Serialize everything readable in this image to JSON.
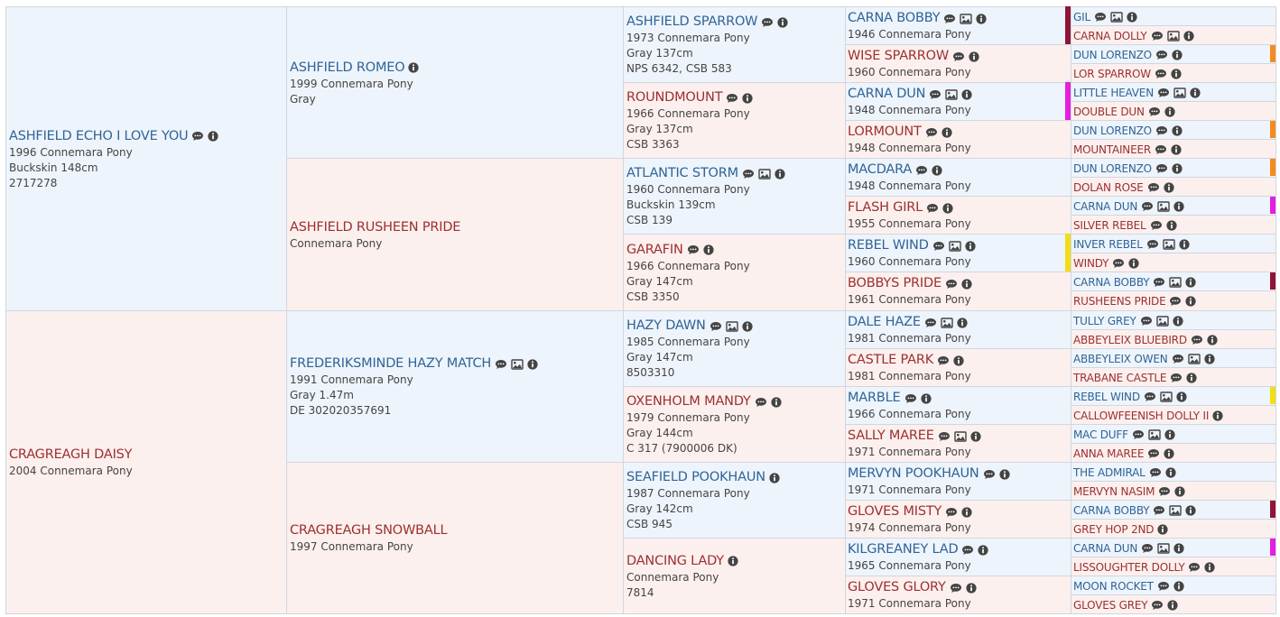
{
  "gen0": [
    {
      "name": "ASHFIELD ECHO I LOVE YOU",
      "sex": "m",
      "icons": [
        "comment-icon",
        "info-icon"
      ],
      "lines": [
        "1996 Connemara Pony",
        "Buckskin 148cm",
        "2717278"
      ]
    },
    {
      "name": "CRAGREAGH DAISY",
      "sex": "f",
      "icons": [],
      "lines": [
        "2004 Connemara Pony"
      ]
    }
  ],
  "gen1": [
    {
      "name": "ASHFIELD ROMEO",
      "sex": "m",
      "icons": [
        "info-icon"
      ],
      "lines": [
        "1999 Connemara Pony",
        "Gray"
      ]
    },
    {
      "name": "ASHFIELD RUSHEEN PRIDE",
      "sex": "f",
      "icons": [],
      "lines": [
        "Connemara Pony"
      ]
    },
    {
      "name": "FREDERIKSMINDE HAZY MATCH",
      "sex": "m",
      "icons": [
        "comment-icon",
        "photo-icon",
        "info-icon"
      ],
      "lines": [
        "1991 Connemara Pony",
        "Gray 1.47m",
        "DE 302020357691"
      ]
    },
    {
      "name": "CRAGREAGH SNOWBALL",
      "sex": "f",
      "icons": [],
      "lines": [
        "1997 Connemara Pony"
      ]
    }
  ],
  "gen2": [
    {
      "name": "ASHFIELD SPARROW",
      "sex": "m",
      "icons": [
        "comment-icon",
        "info-icon"
      ],
      "lines": [
        "1973 Connemara Pony",
        "Gray 137cm",
        "NPS 6342, CSB 583"
      ]
    },
    {
      "name": "ROUNDMOUNT",
      "sex": "f",
      "icons": [
        "comment-icon",
        "info-icon"
      ],
      "lines": [
        "1966 Connemara Pony",
        "Gray 137cm",
        "CSB 3363"
      ]
    },
    {
      "name": "ATLANTIC STORM",
      "sex": "m",
      "icons": [
        "comment-icon",
        "photo-icon",
        "info-icon"
      ],
      "lines": [
        "1960 Connemara Pony",
        "Buckskin 139cm",
        "CSB 139"
      ]
    },
    {
      "name": "GARAFIN",
      "sex": "f",
      "icons": [
        "comment-icon",
        "info-icon"
      ],
      "lines": [
        "1966 Connemara Pony",
        "Gray 147cm",
        "CSB 3350"
      ]
    },
    {
      "name": "HAZY DAWN",
      "sex": "m",
      "icons": [
        "comment-icon",
        "photo-icon",
        "info-icon"
      ],
      "lines": [
        "1985 Connemara Pony",
        "Gray 147cm",
        "8503310"
      ]
    },
    {
      "name": "OXENHOLM MANDY",
      "sex": "f",
      "icons": [
        "comment-icon",
        "info-icon"
      ],
      "lines": [
        "1979 Connemara Pony",
        "Gray 144cm",
        "C 317 (7900006 DK)"
      ]
    },
    {
      "name": "SEAFIELD POOKHAUN",
      "sex": "m",
      "icons": [
        "info-icon"
      ],
      "lines": [
        "1987 Connemara Pony",
        "Gray 142cm",
        "CSB 945"
      ]
    },
    {
      "name": "DANCING LADY",
      "sex": "f",
      "icons": [
        "info-icon"
      ],
      "lines": [
        "Connemara Pony",
        "7814"
      ]
    }
  ],
  "gen3": [
    {
      "name": "CARNA BOBBY",
      "sex": "m",
      "icons": [
        "comment-icon",
        "photo-icon",
        "info-icon"
      ],
      "lines": [
        "1946 Connemara Pony"
      ]
    },
    {
      "name": "WISE SPARROW",
      "sex": "f",
      "icons": [
        "comment-icon",
        "info-icon"
      ],
      "lines": [
        "1960 Connemara Pony"
      ]
    },
    {
      "name": "CARNA DUN",
      "sex": "m",
      "icons": [
        "comment-icon",
        "photo-icon",
        "info-icon"
      ],
      "lines": [
        "1948 Connemara Pony"
      ]
    },
    {
      "name": "LORMOUNT",
      "sex": "f",
      "icons": [
        "comment-icon",
        "info-icon"
      ],
      "lines": [
        "1948 Connemara Pony"
      ]
    },
    {
      "name": "MACDARA",
      "sex": "m",
      "icons": [
        "comment-icon",
        "info-icon"
      ],
      "lines": [
        "1948 Connemara Pony"
      ]
    },
    {
      "name": "FLASH GIRL",
      "sex": "f",
      "icons": [
        "comment-icon",
        "info-icon"
      ],
      "lines": [
        "1955 Connemara Pony"
      ]
    },
    {
      "name": "REBEL WIND",
      "sex": "m",
      "icons": [
        "comment-icon",
        "photo-icon",
        "info-icon"
      ],
      "lines": [
        "1960 Connemara Pony"
      ]
    },
    {
      "name": "BOBBYS PRIDE",
      "sex": "f",
      "icons": [
        "comment-icon",
        "info-icon"
      ],
      "lines": [
        "1961 Connemara Pony"
      ]
    },
    {
      "name": "DALE HAZE",
      "sex": "m",
      "icons": [
        "comment-icon",
        "photo-icon",
        "info-icon"
      ],
      "lines": [
        "1981 Connemara Pony"
      ]
    },
    {
      "name": "CASTLE PARK",
      "sex": "f",
      "icons": [
        "comment-icon",
        "info-icon"
      ],
      "lines": [
        "1981 Connemara Pony"
      ]
    },
    {
      "name": "MARBLE",
      "sex": "m",
      "icons": [
        "comment-icon",
        "info-icon"
      ],
      "lines": [
        "1966 Connemara Pony"
      ]
    },
    {
      "name": "SALLY MAREE",
      "sex": "f",
      "icons": [
        "comment-icon",
        "photo-icon",
        "info-icon"
      ],
      "lines": [
        "1971 Connemara Pony"
      ]
    },
    {
      "name": "MERVYN POOKHAUN",
      "sex": "m",
      "icons": [
        "comment-icon",
        "info-icon"
      ],
      "lines": [
        "1971 Connemara Pony"
      ]
    },
    {
      "name": "GLOVES MISTY",
      "sex": "f",
      "icons": [
        "comment-icon",
        "info-icon"
      ],
      "lines": [
        "1974 Connemara Pony"
      ]
    },
    {
      "name": "KILGREANEY LAD",
      "sex": "m",
      "icons": [
        "comment-icon",
        "info-icon"
      ],
      "lines": [
        "1965 Connemara Pony"
      ]
    },
    {
      "name": "GLOVES GLORY",
      "sex": "f",
      "icons": [
        "comment-icon",
        "info-icon"
      ],
      "lines": [
        "1971 Connemara Pony"
      ]
    }
  ],
  "gen4": [
    {
      "name": "GIL",
      "sex": "m",
      "icons": [
        "comment-icon",
        "photo-icon",
        "info-icon"
      ]
    },
    {
      "name": "CARNA DOLLY",
      "sex": "f",
      "icons": [
        "comment-icon",
        "photo-icon",
        "info-icon"
      ]
    },
    {
      "name": "DUN LORENZO",
      "sex": "m",
      "icons": [
        "comment-icon",
        "info-icon"
      ]
    },
    {
      "name": "LOR SPARROW",
      "sex": "f",
      "icons": [
        "comment-icon",
        "info-icon"
      ]
    },
    {
      "name": "LITTLE HEAVEN",
      "sex": "m",
      "icons": [
        "comment-icon",
        "photo-icon",
        "info-icon"
      ]
    },
    {
      "name": "DOUBLE DUN",
      "sex": "f",
      "icons": [
        "comment-icon",
        "info-icon"
      ]
    },
    {
      "name": "DUN LORENZO",
      "sex": "m",
      "icons": [
        "comment-icon",
        "info-icon"
      ]
    },
    {
      "name": "MOUNTAINEER",
      "sex": "f",
      "icons": [
        "comment-icon",
        "info-icon"
      ]
    },
    {
      "name": "DUN LORENZO",
      "sex": "m",
      "icons": [
        "comment-icon",
        "info-icon"
      ]
    },
    {
      "name": "DOLAN ROSE",
      "sex": "f",
      "icons": [
        "comment-icon",
        "info-icon"
      ]
    },
    {
      "name": "CARNA DUN",
      "sex": "m",
      "icons": [
        "comment-icon",
        "photo-icon",
        "info-icon"
      ]
    },
    {
      "name": "SILVER REBEL",
      "sex": "f",
      "icons": [
        "comment-icon",
        "info-icon"
      ]
    },
    {
      "name": "INVER REBEL",
      "sex": "m",
      "icons": [
        "comment-icon",
        "photo-icon",
        "info-icon"
      ]
    },
    {
      "name": "WINDY",
      "sex": "f",
      "icons": [
        "comment-icon",
        "info-icon"
      ]
    },
    {
      "name": "CARNA BOBBY",
      "sex": "m",
      "icons": [
        "comment-icon",
        "photo-icon",
        "info-icon"
      ]
    },
    {
      "name": "RUSHEENS PRIDE",
      "sex": "f",
      "icons": [
        "comment-icon",
        "info-icon"
      ]
    },
    {
      "name": "TULLY GREY",
      "sex": "m",
      "icons": [
        "comment-icon",
        "photo-icon",
        "info-icon"
      ]
    },
    {
      "name": "ABBEYLEIX BLUEBIRD",
      "sex": "f",
      "icons": [
        "comment-icon",
        "info-icon"
      ]
    },
    {
      "name": "ABBEYLEIX OWEN",
      "sex": "m",
      "icons": [
        "comment-icon",
        "photo-icon",
        "info-icon"
      ]
    },
    {
      "name": "TRABANE CASTLE",
      "sex": "f",
      "icons": [
        "comment-icon",
        "info-icon"
      ]
    },
    {
      "name": "REBEL WIND",
      "sex": "m",
      "icons": [
        "comment-icon",
        "photo-icon",
        "info-icon"
      ]
    },
    {
      "name": "CALLOWFEENISH DOLLY II",
      "sex": "f",
      "icons": [
        "info-icon"
      ]
    },
    {
      "name": "MAC DUFF",
      "sex": "m",
      "icons": [
        "comment-icon",
        "photo-icon",
        "info-icon"
      ]
    },
    {
      "name": "ANNA MAREE",
      "sex": "f",
      "icons": [
        "comment-icon",
        "info-icon"
      ]
    },
    {
      "name": "THE ADMIRAL",
      "sex": "m",
      "icons": [
        "comment-icon",
        "info-icon"
      ]
    },
    {
      "name": "MERVYN NASIM",
      "sex": "f",
      "icons": [
        "comment-icon",
        "info-icon"
      ]
    },
    {
      "name": "CARNA BOBBY",
      "sex": "m",
      "icons": [
        "comment-icon",
        "photo-icon",
        "info-icon"
      ]
    },
    {
      "name": "GREY HOP 2ND",
      "sex": "f",
      "icons": [
        "info-icon"
      ]
    },
    {
      "name": "CARNA DUN",
      "sex": "m",
      "icons": [
        "comment-icon",
        "photo-icon",
        "info-icon"
      ]
    },
    {
      "name": "LISSOUGHTER DOLLY",
      "sex": "f",
      "icons": [
        "comment-icon",
        "info-icon"
      ]
    },
    {
      "name": "MOON ROCKET",
      "sex": "m",
      "icons": [
        "comment-icon",
        "info-icon"
      ]
    },
    {
      "name": "GLOVES GREY",
      "sex": "f",
      "icons": [
        "comment-icon",
        "info-icon"
      ]
    }
  ],
  "duplicate_markers": {
    "colors": {
      "maroon": "#8e1538",
      "orange": "#f58a1f",
      "magenta": "#e61ee0",
      "yellow": "#f2de14"
    },
    "left_of_gen4": [
      {
        "row": 0,
        "span": 2,
        "color": "maroon"
      },
      {
        "row": 4,
        "span": 2,
        "color": "magenta"
      },
      {
        "row": 12,
        "span": 2,
        "color": "yellow"
      }
    ],
    "right_of_gen4": [
      {
        "row": 2,
        "color": "orange"
      },
      {
        "row": 6,
        "color": "orange"
      },
      {
        "row": 8,
        "color": "orange"
      },
      {
        "row": 10,
        "color": "magenta"
      },
      {
        "row": 14,
        "color": "maroon"
      },
      {
        "row": 20,
        "color": "yellow"
      },
      {
        "row": 26,
        "color": "maroon"
      },
      {
        "row": 28,
        "color": "magenta"
      }
    ]
  },
  "colors": {
    "male_bg": "#eef4fb",
    "female_bg": "#fcf0ee",
    "male_name": "#2e6497",
    "female_name": "#9c2f2f",
    "icon": "#444444"
  }
}
